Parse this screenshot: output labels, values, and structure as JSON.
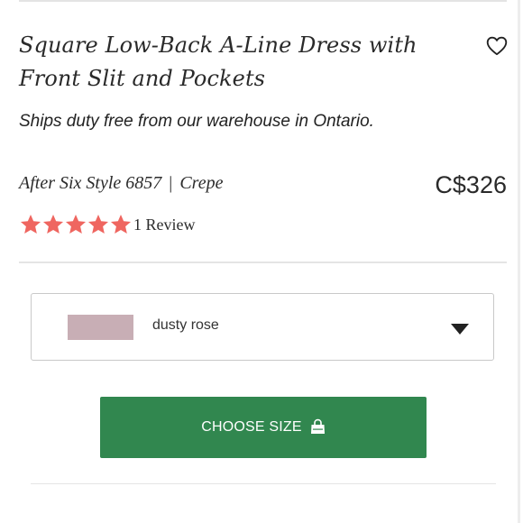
{
  "product": {
    "title": "Square Low-Back A-Line Dress with Front Slit and Pockets",
    "shipping_note": "Ships duty free from our warehouse in Ontario.",
    "style": "After Six Style 6857",
    "separator": "|",
    "fabric": "Crepe",
    "price": "C$326"
  },
  "rating": {
    "stars": 5,
    "max_stars": 5,
    "review_label": "1 Review"
  },
  "color_select": {
    "selected": "dusty rose",
    "swatch_color": "#c8aeb5"
  },
  "cta": {
    "label": "CHOOSE SIZE",
    "icon": "shopping-bag-icon"
  },
  "icons": {
    "wishlist": "heart-outline-icon",
    "dropdown": "chevron-down-icon",
    "star": "star-icon"
  },
  "colors": {
    "star": "#ef6660",
    "cta_background": "#31874f",
    "text": "#222222",
    "divider": "#e4e4e4",
    "select_border": "#c9c9c9"
  }
}
